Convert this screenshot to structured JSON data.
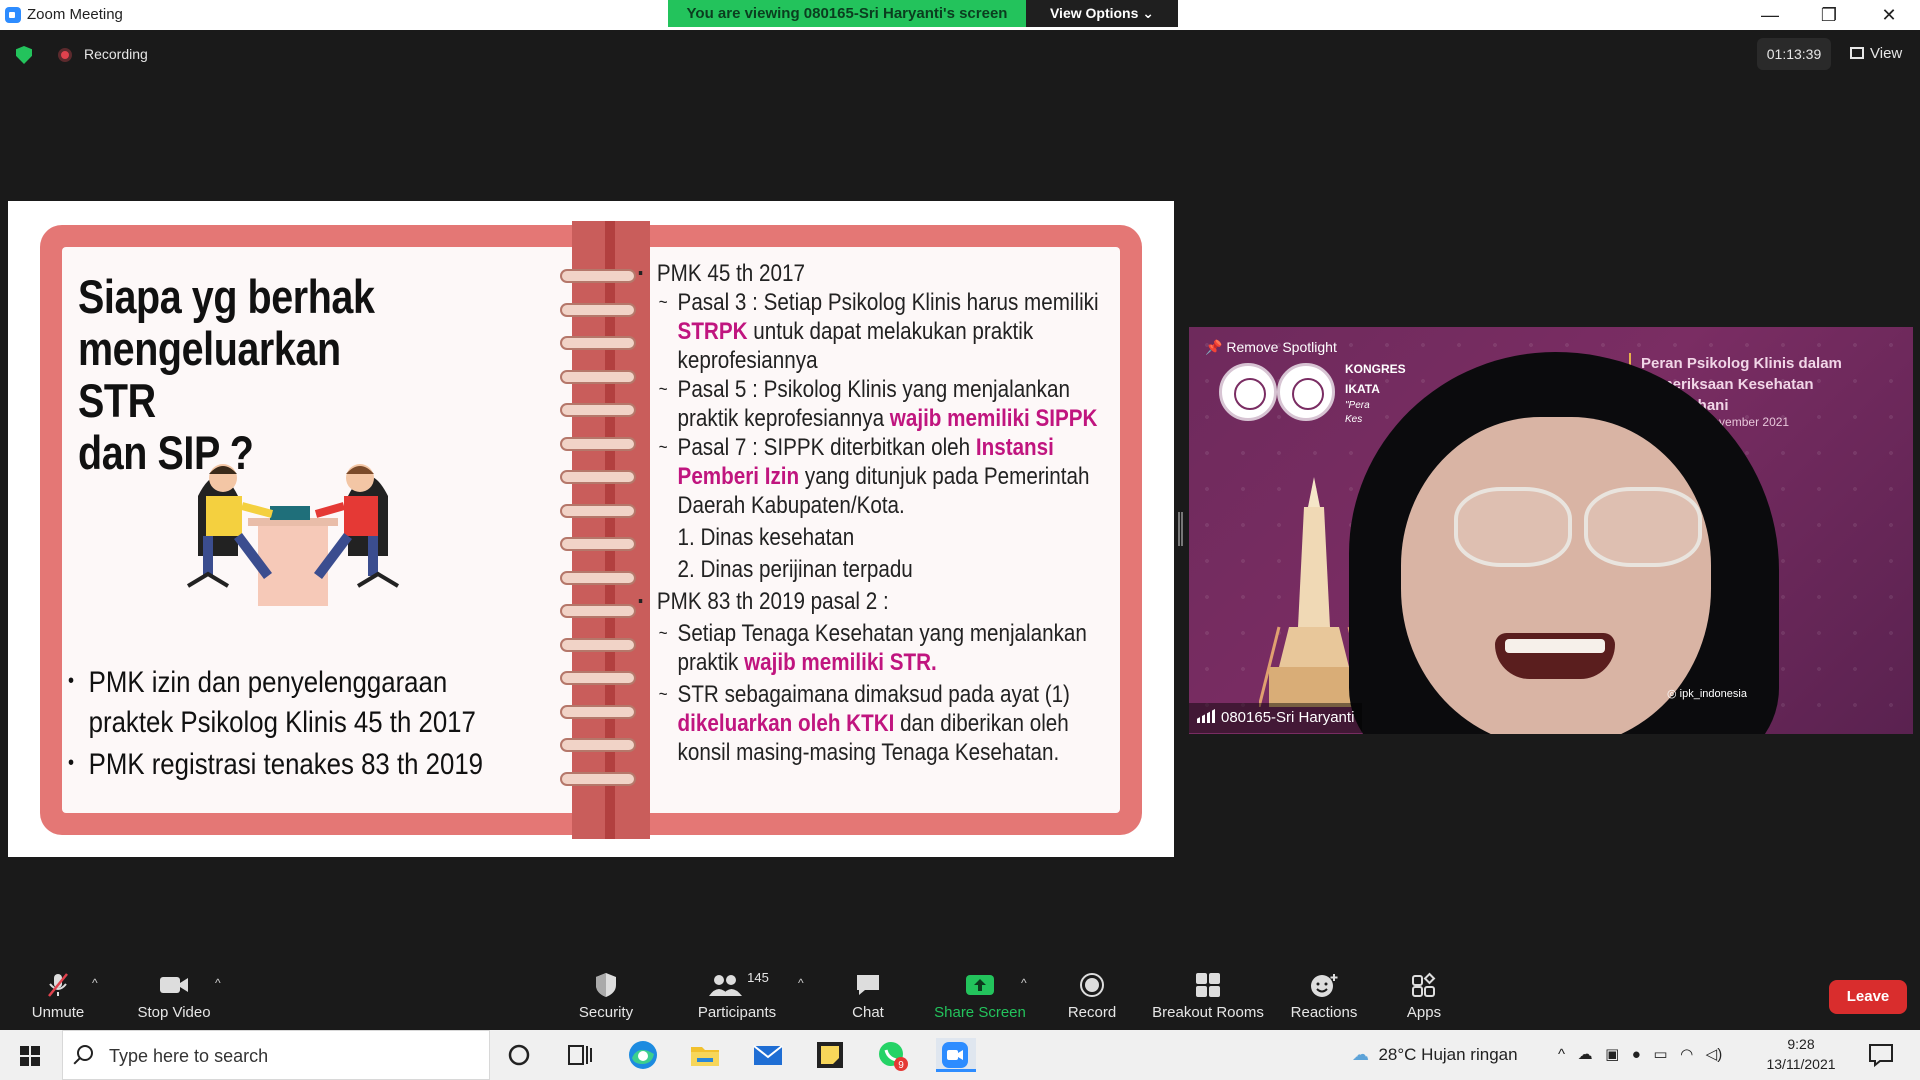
{
  "window": {
    "title": "Zoom Meeting",
    "viewing_banner": "You are viewing 080165-Sri Haryanti's screen",
    "view_options": "View Options ⌄",
    "minimize": "—",
    "restore": "❐",
    "close": "✕"
  },
  "meeting": {
    "recording_label": "Recording",
    "timer": "01:13:39",
    "view_label": "View"
  },
  "slide": {
    "title_lines": [
      "Siapa yg berhak",
      "mengeluarkan STR",
      "dan SIP ?"
    ],
    "left_bullets": [
      "PMK izin dan penyelenggaraan praktek Psikolog Klinis 45 th 2017",
      "PMK registrasi tenakes 83 th 2019"
    ],
    "right": {
      "h1": "PMK 45  th 2017",
      "p3a": "Pasal 3 : Setiap Psikolog Klinis harus memiliki",
      "p3b_hl": "STRPK",
      "p3b": " untuk dapat melakukan praktik",
      "p3c": "keprofesiannya",
      "p5a": "Pasal 5 : Psikolog Klinis yang menjalankan",
      "p5b": "praktik keprofesiannya ",
      "p5b_hl": "wajib memiliki SIPPK",
      "p7a": "Pasal 7 : SIPPK diterbitkan oleh ",
      "p7a_hl": "Instansi",
      "p7b_hl": "Pemberi Izin",
      "p7b": " yang  ditunjuk pada Pemerintah",
      "p7c": "Daerah Kabupaten/Kota.",
      "n1": "1. Dinas kesehatan",
      "n2": "2. Dinas perijinan terpadu",
      "h2": "PMK 83 th 2019 pasal 2 :",
      "s1a": "Setiap Tenaga Kesehatan yang menjalankan",
      "s1b": "praktik ",
      "s1b_hl": "wajib memiliki STR.",
      "s2a": "STR sebagaimana dimaksud pada ayat (1)",
      "s2b_hl": "dikeluarkan oleh KTKI",
      "s2b": " dan diberikan oleh",
      "s2c": "konsil masing-masing Tenaga Kesehatan."
    }
  },
  "video": {
    "spotlight_label": "Remove Spotlight",
    "kongres_lines": [
      "KONGRES",
      "IKATA",
      "\"Pera",
      "Kes"
    ],
    "year_fragment": "2021",
    "topic_lines": [
      "Peran Psikolog Klinis dalam",
      "Pemeriksaan Kesehatan",
      "Jiwa/Rohani"
    ],
    "topic_date": "Minggu, 13 November 2021",
    "ig_handle": "ipk_indonesia",
    "participant_name": "080165-Sri Haryanti"
  },
  "toolbar": {
    "unmute": "Unmute",
    "stop_video": "Stop Video",
    "security": "Security",
    "participants": "Participants",
    "participants_count": "145",
    "chat": "Chat",
    "share_screen": "Share Screen",
    "record": "Record",
    "breakout_rooms": "Breakout Rooms",
    "reactions": "Reactions",
    "apps": "Apps",
    "leave": "Leave",
    "caret": "^"
  },
  "taskbar": {
    "search_placeholder": "Type here to search",
    "weather": "28°C  Hujan ringan",
    "time": "9:28",
    "date": "13/11/2021",
    "whatsapp_badge": "9"
  },
  "colors": {
    "zoom_blue": "#2d8cff",
    "banner_green": "#23c35c",
    "leave_red": "#d92d2d",
    "notebook_pink": "#e47775",
    "highlight_magenta": "#c0157f"
  }
}
